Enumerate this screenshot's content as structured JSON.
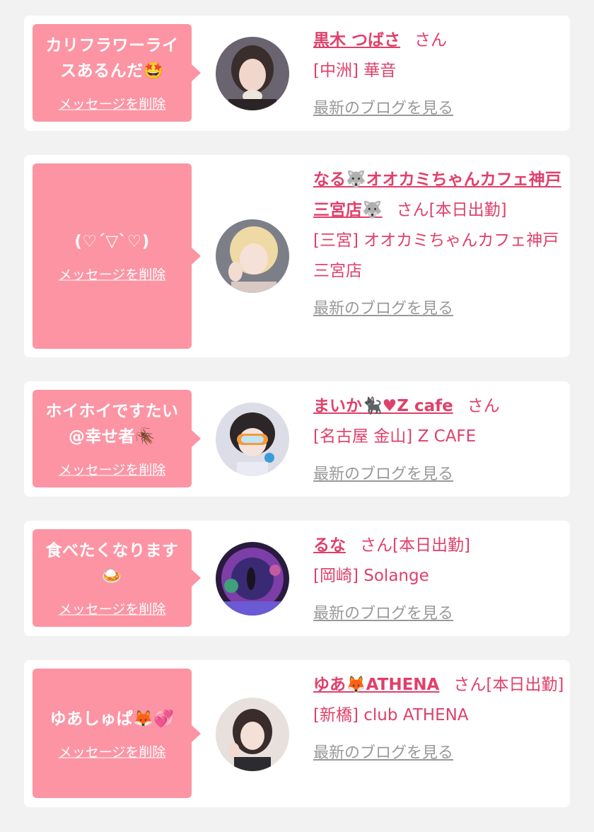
{
  "delete_label": "メッセージを削除",
  "blog_label": "最新のブログを見る",
  "colors": {
    "bubble": "#fc94a4",
    "accent": "#e0406a",
    "muted": "#999999",
    "background": "#f2f2f2"
  },
  "items": [
    {
      "message": "カリフラワーライスあるんだ🤩",
      "name": "黒木 つばさ",
      "suffix": "さん",
      "area_shop": "[中洲] 華音"
    },
    {
      "message": "(♡´▽`♡)",
      "name": "なる🐺オオカミちゃんカフェ神戸三宮店🐺",
      "suffix": "さん[本日出勤]",
      "area_shop": "[三宮] オオカミちゃんカフェ神戸三宮店"
    },
    {
      "message": "ホイホイですたい@幸せ者🪳",
      "name": "まいか🐈‍⬛♥Z cafe",
      "suffix": "さん",
      "area_shop": "[名古屋 金山] Z CAFE"
    },
    {
      "message": "食べたくなります🍛",
      "name": "るな",
      "suffix": "さん[本日出勤]",
      "area_shop": "[岡崎] Solange"
    },
    {
      "message": "ゆあしゅぱ🦊💞",
      "name": "ゆあ🦊ATHENA",
      "suffix": "さん[本日出勤]",
      "area_shop": "[新橋] club ATHENA"
    }
  ]
}
